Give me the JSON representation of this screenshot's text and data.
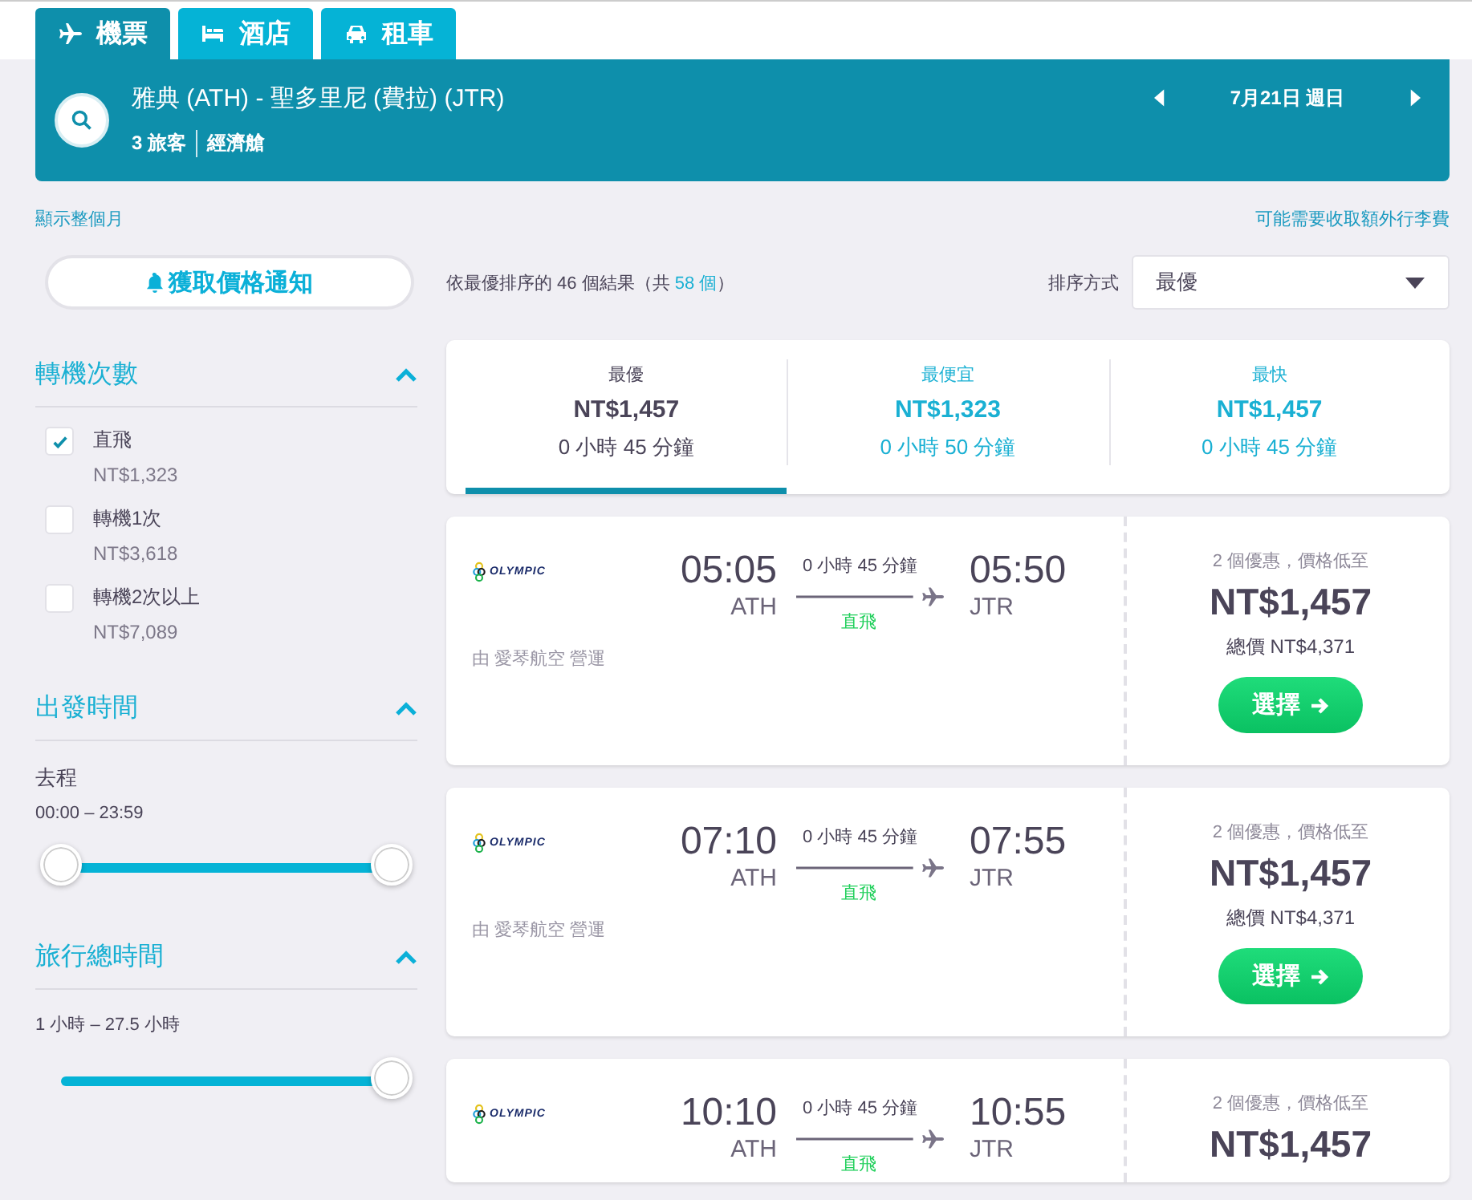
{
  "tabs": [
    {
      "label": "機票",
      "kind": "flights",
      "selected": true
    },
    {
      "label": "酒店",
      "kind": "hotels",
      "selected": false
    },
    {
      "label": "租車",
      "kind": "cars",
      "selected": false
    }
  ],
  "search": {
    "route": "雅典 (ATH) - 聖多里尼 (費拉) (JTR)",
    "travelers": "3 旅客",
    "cabin": "經濟艙",
    "date": "7月21日 週日"
  },
  "links": {
    "month": "顯示整個月",
    "baggage": "可能需要收取額外行李費"
  },
  "alert_button": "獲取價格通知",
  "filters": {
    "stops": {
      "title": "轉機次數",
      "expanded": true,
      "options": [
        {
          "label": "直飛",
          "price": "NT$1,323",
          "checked": true
        },
        {
          "label": "轉機1次",
          "price": "NT$3,618",
          "checked": false
        },
        {
          "label": "轉機2次以上",
          "price": "NT$7,089",
          "checked": false
        }
      ]
    },
    "departure": {
      "title": "出發時間",
      "expanded": true,
      "leg": "去程",
      "range": "00:00 – 23:59",
      "thumbs": [
        {
          "level": 0
        },
        {
          "level": 1
        }
      ]
    },
    "duration": {
      "title": "旅行總時間",
      "expanded": true,
      "range": "1 小時 – 27.5 小時",
      "thumbs": [
        {
          "level": 1
        }
      ]
    }
  },
  "results": {
    "summary_prefix": "依最優排序的 46 個結果（共",
    "total": "58 個",
    "summary_suffix": "）",
    "sort_label": "排序方式",
    "sort_value": "最優"
  },
  "sort_tabs": [
    {
      "label": "最優",
      "price": "NT$1,457",
      "duration": "0 小時 45 分鐘",
      "selected": true
    },
    {
      "label": "最便宜",
      "price": "NT$1,323",
      "duration": "0 小時 50 分鐘",
      "selected": false
    },
    {
      "label": "最快",
      "price": "NT$1,457",
      "duration": "0 小時 45 分鐘",
      "selected": false
    }
  ],
  "flights": [
    {
      "logo": "OLYMPIC",
      "depart": "05:05",
      "from": "ATH",
      "duration": "0 小時 45 分鐘",
      "stops": "直飛",
      "arrive": "05:50",
      "to": "JTR",
      "operator": "由 愛琴航空 營運",
      "deals": "2 個優惠，價格低至",
      "price": "NT$1,457",
      "total": "總價 NT$4,371",
      "button": "選擇"
    },
    {
      "logo": "OLYMPIC",
      "depart": "07:10",
      "from": "ATH",
      "duration": "0 小時 45 分鐘",
      "stops": "直飛",
      "arrive": "07:55",
      "to": "JTR",
      "operator": "由 愛琴航空 營運",
      "deals": "2 個優惠，價格低至",
      "price": "NT$1,457",
      "total": "總價 NT$4,371",
      "button": "選擇"
    },
    {
      "logo": "OLYMPIC",
      "depart": "10:10",
      "from": "ATH",
      "duration": "0 小時 45 分鐘",
      "stops": "直飛",
      "arrive": "10:55",
      "to": "JTR",
      "deals": "2 個優惠，價格低至",
      "price": "NT$1,457"
    }
  ]
}
